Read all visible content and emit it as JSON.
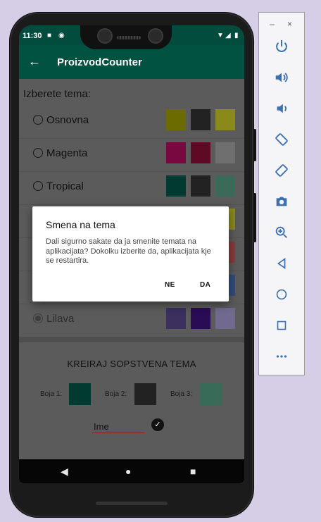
{
  "status_bar": {
    "time": "11:30",
    "icons_left": [
      "lock-icon",
      "at-icon"
    ],
    "icons_right": [
      "wifi-icon",
      "signal-icon",
      "battery-icon"
    ]
  },
  "app_bar": {
    "title": "ProizvodCounter",
    "back_icon": "arrow-left-icon"
  },
  "theme_section": {
    "heading": "Izberete tema:",
    "themes": [
      {
        "name": "Osnovna",
        "colors": [
          "#6b6b00",
          "#222222",
          "#8a8a1a"
        ],
        "selected": false
      },
      {
        "name": "Magenta",
        "colors": [
          "#7a0840",
          "#5e0a24",
          "#6f6f6f"
        ],
        "selected": false
      },
      {
        "name": "Tropical",
        "colors": [
          "#013a2e",
          "#222222",
          "#3a6a58"
        ],
        "selected": false
      },
      {
        "name": "",
        "colors": [
          "",
          "",
          "#8a8a1a"
        ],
        "selected": false
      },
      {
        "name": "",
        "colors": [
          "",
          "",
          "#8a3a3a"
        ],
        "selected": false
      },
      {
        "name": "",
        "colors": [
          "",
          "",
          "#2f4c80"
        ],
        "selected": false
      },
      {
        "name": "Lilava",
        "colors": [
          "#3b305e",
          "#2a0b55",
          "#716a8e"
        ],
        "selected": true
      }
    ]
  },
  "custom_theme": {
    "heading": "KREIRAJ SOPSTVENA TEMA",
    "colors": [
      {
        "label": "Boja 1:",
        "color": "#013a2e"
      },
      {
        "label": "Boja 2:",
        "color": "#222222"
      },
      {
        "label": "Boja 3:",
        "color": "#3a6a58"
      }
    ],
    "name_input": {
      "value": "Ime",
      "placeholder": ""
    },
    "confirm_icon": "check-circle-icon"
  },
  "dialog": {
    "title": "Smena na tema",
    "message": "Dali sigurno sakate da ja smenite temata na aplikacijata? Dokolku izberite da, aplikacijata kje se restartira.",
    "negative_label": "NE",
    "positive_label": "DA"
  },
  "nav_bar": {
    "icons": [
      "back-triangle-icon",
      "home-circle-icon",
      "recents-square-icon"
    ]
  },
  "emulator_toolbar": {
    "minimize_label": "–",
    "close_label": "×",
    "buttons": [
      "power-icon",
      "volume-up-icon",
      "volume-down-icon",
      "rotate-left-icon",
      "rotate-right-icon",
      "camera-icon",
      "zoom-in-icon",
      "back-icon",
      "home-icon",
      "overview-icon",
      "more-icon"
    ]
  },
  "colors": {
    "primary": "#015240",
    "status_bar": "#014c3d",
    "toolbar_icon": "#3a6fb5"
  }
}
